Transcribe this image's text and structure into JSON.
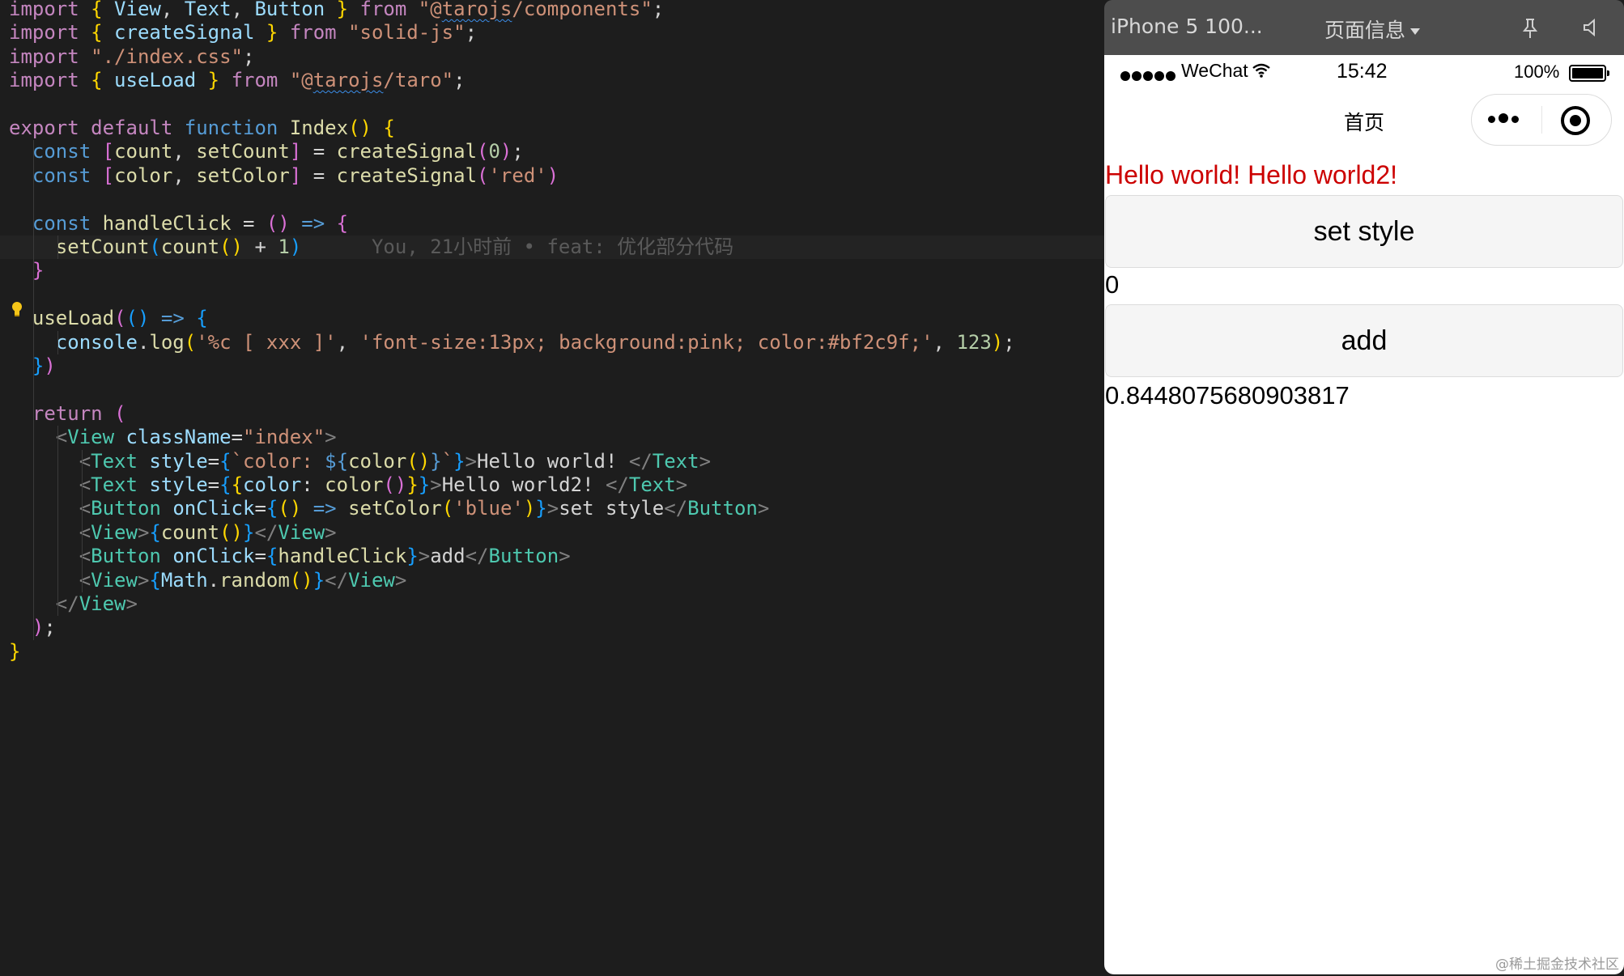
{
  "editor": {
    "lines": [
      [
        {
          "c": "kw-ctrl",
          "t": "import"
        },
        {
          "c": "text",
          "t": " "
        },
        {
          "c": "p1",
          "t": "{"
        },
        {
          "c": "var",
          "t": " View"
        },
        {
          "c": "text",
          "t": ", "
        },
        {
          "c": "var",
          "t": "Text"
        },
        {
          "c": "text",
          "t": ", "
        },
        {
          "c": "var",
          "t": "Button"
        },
        {
          "c": "text",
          "t": " "
        },
        {
          "c": "p1",
          "t": "}"
        },
        {
          "c": "text",
          "t": " "
        },
        {
          "c": "kw-ctrl",
          "t": "from"
        },
        {
          "c": "text",
          "t": " "
        },
        {
          "c": "str",
          "t": "\"@"
        },
        {
          "c": "str squig",
          "t": "tarojs"
        },
        {
          "c": "str",
          "t": "/components\""
        },
        {
          "c": "text",
          "t": ";"
        }
      ],
      [
        {
          "c": "kw-ctrl",
          "t": "import"
        },
        {
          "c": "text",
          "t": " "
        },
        {
          "c": "p1",
          "t": "{"
        },
        {
          "c": "var",
          "t": " createSignal"
        },
        {
          "c": "text",
          "t": " "
        },
        {
          "c": "p1",
          "t": "}"
        },
        {
          "c": "text",
          "t": " "
        },
        {
          "c": "kw-ctrl",
          "t": "from"
        },
        {
          "c": "text",
          "t": " "
        },
        {
          "c": "str",
          "t": "\"solid-js\""
        },
        {
          "c": "text",
          "t": ";"
        }
      ],
      [
        {
          "c": "kw-ctrl",
          "t": "import"
        },
        {
          "c": "text",
          "t": " "
        },
        {
          "c": "str",
          "t": "\"./index.css\""
        },
        {
          "c": "text",
          "t": ";"
        }
      ],
      [
        {
          "c": "kw-ctrl",
          "t": "import"
        },
        {
          "c": "text",
          "t": " "
        },
        {
          "c": "p1",
          "t": "{"
        },
        {
          "c": "var",
          "t": " useLoad"
        },
        {
          "c": "text",
          "t": " "
        },
        {
          "c": "p1",
          "t": "}"
        },
        {
          "c": "text",
          "t": " "
        },
        {
          "c": "kw-ctrl",
          "t": "from"
        },
        {
          "c": "text",
          "t": " "
        },
        {
          "c": "str",
          "t": "\"@"
        },
        {
          "c": "str squig",
          "t": "tarojs"
        },
        {
          "c": "str",
          "t": "/taro\""
        },
        {
          "c": "text",
          "t": ";"
        }
      ],
      [],
      [
        {
          "c": "kw-ctrl",
          "t": "export"
        },
        {
          "c": "text",
          "t": " "
        },
        {
          "c": "kw-ctrl",
          "t": "default"
        },
        {
          "c": "text",
          "t": " "
        },
        {
          "c": "kw",
          "t": "function"
        },
        {
          "c": "text",
          "t": " "
        },
        {
          "c": "fn",
          "t": "Index"
        },
        {
          "c": "p1",
          "t": "()"
        },
        {
          "c": "text",
          "t": " "
        },
        {
          "c": "p1",
          "t": "{"
        }
      ],
      [
        {
          "c": "text",
          "t": "  "
        },
        {
          "c": "kw",
          "t": "const"
        },
        {
          "c": "text",
          "t": " "
        },
        {
          "c": "p2",
          "t": "["
        },
        {
          "c": "fn",
          "t": "count"
        },
        {
          "c": "text",
          "t": ", "
        },
        {
          "c": "fn",
          "t": "setCount"
        },
        {
          "c": "p2",
          "t": "]"
        },
        {
          "c": "text",
          "t": " = "
        },
        {
          "c": "fn",
          "t": "createSignal"
        },
        {
          "c": "p2",
          "t": "("
        },
        {
          "c": "num",
          "t": "0"
        },
        {
          "c": "p2",
          "t": ")"
        },
        {
          "c": "text",
          "t": ";"
        }
      ],
      [
        {
          "c": "text",
          "t": "  "
        },
        {
          "c": "kw",
          "t": "const"
        },
        {
          "c": "text",
          "t": " "
        },
        {
          "c": "p2",
          "t": "["
        },
        {
          "c": "fn",
          "t": "color"
        },
        {
          "c": "text",
          "t": ", "
        },
        {
          "c": "fn",
          "t": "setColor"
        },
        {
          "c": "p2",
          "t": "]"
        },
        {
          "c": "text",
          "t": " = "
        },
        {
          "c": "fn",
          "t": "createSignal"
        },
        {
          "c": "p2",
          "t": "("
        },
        {
          "c": "str",
          "t": "'red'"
        },
        {
          "c": "p2",
          "t": ")"
        }
      ],
      [],
      [
        {
          "c": "text",
          "t": "  "
        },
        {
          "c": "kw",
          "t": "const"
        },
        {
          "c": "text",
          "t": " "
        },
        {
          "c": "fn",
          "t": "handleClick"
        },
        {
          "c": "text",
          "t": " = "
        },
        {
          "c": "p2",
          "t": "()"
        },
        {
          "c": "text",
          "t": " "
        },
        {
          "c": "kw",
          "t": "=>"
        },
        {
          "c": "text",
          "t": " "
        },
        {
          "c": "p2",
          "t": "{"
        }
      ],
      [
        {
          "c": "text",
          "t": "    "
        },
        {
          "c": "fn",
          "t": "setCount"
        },
        {
          "c": "p3",
          "t": "("
        },
        {
          "c": "fn",
          "t": "count"
        },
        {
          "c": "p1",
          "t": "()"
        },
        {
          "c": "text",
          "t": " + "
        },
        {
          "c": "num",
          "t": "1"
        },
        {
          "c": "p3",
          "t": ")"
        },
        {
          "c": "text",
          "t": "      "
        },
        {
          "c": "blame",
          "t": "You, 21小时前 • feat: 优化部分代码"
        }
      ],
      [
        {
          "c": "text",
          "t": "  "
        },
        {
          "c": "p2",
          "t": "}"
        }
      ],
      [],
      [
        {
          "c": "text",
          "t": "  "
        },
        {
          "c": "fn",
          "t": "useLoad"
        },
        {
          "c": "p2",
          "t": "("
        },
        {
          "c": "p3",
          "t": "()"
        },
        {
          "c": "text",
          "t": " "
        },
        {
          "c": "kw",
          "t": "=>"
        },
        {
          "c": "text",
          "t": " "
        },
        {
          "c": "p3",
          "t": "{"
        }
      ],
      [
        {
          "c": "text",
          "t": "    "
        },
        {
          "c": "var",
          "t": "console"
        },
        {
          "c": "text",
          "t": "."
        },
        {
          "c": "fn",
          "t": "log"
        },
        {
          "c": "p1",
          "t": "("
        },
        {
          "c": "str",
          "t": "'%c [ xxx ]'"
        },
        {
          "c": "text",
          "t": ", "
        },
        {
          "c": "str",
          "t": "'font-size:13px; background:pink; color:#bf2c9f;'"
        },
        {
          "c": "text",
          "t": ", "
        },
        {
          "c": "num",
          "t": "123"
        },
        {
          "c": "p1",
          "t": ")"
        },
        {
          "c": "text",
          "t": ";"
        }
      ],
      [
        {
          "c": "text",
          "t": "  "
        },
        {
          "c": "p3",
          "t": "}"
        },
        {
          "c": "p2",
          "t": ")"
        }
      ],
      [],
      [
        {
          "c": "text",
          "t": "  "
        },
        {
          "c": "kw-ctrl",
          "t": "return"
        },
        {
          "c": "text",
          "t": " "
        },
        {
          "c": "p2",
          "t": "("
        }
      ],
      [
        {
          "c": "text",
          "t": "    "
        },
        {
          "c": "punc",
          "t": "<"
        },
        {
          "c": "tag",
          "t": "View"
        },
        {
          "c": "text",
          "t": " "
        },
        {
          "c": "var",
          "t": "className"
        },
        {
          "c": "text",
          "t": "="
        },
        {
          "c": "str",
          "t": "\"index\""
        },
        {
          "c": "punc",
          "t": ">"
        }
      ],
      [
        {
          "c": "text",
          "t": "      "
        },
        {
          "c": "punc",
          "t": "<"
        },
        {
          "c": "tag",
          "t": "Text"
        },
        {
          "c": "text",
          "t": " "
        },
        {
          "c": "var",
          "t": "style"
        },
        {
          "c": "text",
          "t": "="
        },
        {
          "c": "p3",
          "t": "{"
        },
        {
          "c": "str",
          "t": "`color: "
        },
        {
          "c": "kw",
          "t": "${"
        },
        {
          "c": "fn",
          "t": "color"
        },
        {
          "c": "p1",
          "t": "()"
        },
        {
          "c": "kw",
          "t": "}"
        },
        {
          "c": "str",
          "t": "`"
        },
        {
          "c": "p3",
          "t": "}"
        },
        {
          "c": "punc",
          "t": ">"
        },
        {
          "c": "text",
          "t": "Hello world! "
        },
        {
          "c": "punc",
          "t": "</"
        },
        {
          "c": "tag",
          "t": "Text"
        },
        {
          "c": "punc",
          "t": ">"
        }
      ],
      [
        {
          "c": "text",
          "t": "      "
        },
        {
          "c": "punc",
          "t": "<"
        },
        {
          "c": "tag",
          "t": "Text"
        },
        {
          "c": "text",
          "t": " "
        },
        {
          "c": "var",
          "t": "style"
        },
        {
          "c": "text",
          "t": "="
        },
        {
          "c": "p3",
          "t": "{"
        },
        {
          "c": "p1",
          "t": "{"
        },
        {
          "c": "var",
          "t": "color"
        },
        {
          "c": "text",
          "t": ": "
        },
        {
          "c": "fn",
          "t": "color"
        },
        {
          "c": "p2",
          "t": "()"
        },
        {
          "c": "p1",
          "t": "}"
        },
        {
          "c": "p3",
          "t": "}"
        },
        {
          "c": "punc",
          "t": ">"
        },
        {
          "c": "text",
          "t": "Hello world2! "
        },
        {
          "c": "punc",
          "t": "</"
        },
        {
          "c": "tag",
          "t": "Text"
        },
        {
          "c": "punc",
          "t": ">"
        }
      ],
      [
        {
          "c": "text",
          "t": "      "
        },
        {
          "c": "punc",
          "t": "<"
        },
        {
          "c": "tag",
          "t": "Button"
        },
        {
          "c": "text",
          "t": " "
        },
        {
          "c": "var",
          "t": "onClick"
        },
        {
          "c": "text",
          "t": "="
        },
        {
          "c": "p3",
          "t": "{"
        },
        {
          "c": "p1",
          "t": "()"
        },
        {
          "c": "text",
          "t": " "
        },
        {
          "c": "kw",
          "t": "=>"
        },
        {
          "c": "text",
          "t": " "
        },
        {
          "c": "fn",
          "t": "setColor"
        },
        {
          "c": "p1",
          "t": "("
        },
        {
          "c": "str",
          "t": "'blue'"
        },
        {
          "c": "p1",
          "t": ")"
        },
        {
          "c": "p3",
          "t": "}"
        },
        {
          "c": "punc",
          "t": ">"
        },
        {
          "c": "text",
          "t": "set style"
        },
        {
          "c": "punc",
          "t": "</"
        },
        {
          "c": "tag",
          "t": "Button"
        },
        {
          "c": "punc",
          "t": ">"
        }
      ],
      [
        {
          "c": "text",
          "t": "      "
        },
        {
          "c": "punc",
          "t": "<"
        },
        {
          "c": "tag",
          "t": "View"
        },
        {
          "c": "punc",
          "t": ">"
        },
        {
          "c": "p3",
          "t": "{"
        },
        {
          "c": "fn",
          "t": "count"
        },
        {
          "c": "p1",
          "t": "()"
        },
        {
          "c": "p3",
          "t": "}"
        },
        {
          "c": "punc",
          "t": "</"
        },
        {
          "c": "tag",
          "t": "View"
        },
        {
          "c": "punc",
          "t": ">"
        }
      ],
      [
        {
          "c": "text",
          "t": "      "
        },
        {
          "c": "punc",
          "t": "<"
        },
        {
          "c": "tag",
          "t": "Button"
        },
        {
          "c": "text",
          "t": " "
        },
        {
          "c": "var",
          "t": "onClick"
        },
        {
          "c": "text",
          "t": "="
        },
        {
          "c": "p3",
          "t": "{"
        },
        {
          "c": "fn",
          "t": "handleClick"
        },
        {
          "c": "p3",
          "t": "}"
        },
        {
          "c": "punc",
          "t": ">"
        },
        {
          "c": "text",
          "t": "add"
        },
        {
          "c": "punc",
          "t": "</"
        },
        {
          "c": "tag",
          "t": "Button"
        },
        {
          "c": "punc",
          "t": ">"
        }
      ],
      [
        {
          "c": "text",
          "t": "      "
        },
        {
          "c": "punc",
          "t": "<"
        },
        {
          "c": "tag",
          "t": "View"
        },
        {
          "c": "punc",
          "t": ">"
        },
        {
          "c": "p3",
          "t": "{"
        },
        {
          "c": "var",
          "t": "Math"
        },
        {
          "c": "text",
          "t": "."
        },
        {
          "c": "fn",
          "t": "random"
        },
        {
          "c": "p1",
          "t": "()"
        },
        {
          "c": "p3",
          "t": "}"
        },
        {
          "c": "punc",
          "t": "</"
        },
        {
          "c": "tag",
          "t": "View"
        },
        {
          "c": "punc",
          "t": ">"
        }
      ],
      [
        {
          "c": "text",
          "t": "    "
        },
        {
          "c": "punc",
          "t": "</"
        },
        {
          "c": "tag",
          "t": "View"
        },
        {
          "c": "punc",
          "t": ">"
        }
      ],
      [
        {
          "c": "text",
          "t": "  "
        },
        {
          "c": "p2",
          "t": ")"
        },
        {
          "c": "text",
          "t": ";"
        }
      ],
      [
        {
          "c": "p1",
          "t": "}"
        }
      ]
    ],
    "current_line": 10,
    "lightbulb_icon": "lightbulb-icon"
  },
  "simulator": {
    "toolbar": {
      "device": "iPhone 5 100...",
      "page_info": "页面信息",
      "pin_icon": "pin-icon",
      "sound_icon": "sound-icon"
    },
    "status_bar": {
      "carrier": "WeChat",
      "time": "15:42",
      "battery": "100%"
    },
    "navbar": {
      "title": "首页"
    },
    "page": {
      "hello_text": "Hello world! Hello world2!",
      "hello_color": "#cc0000",
      "set_style_label": "set style",
      "count_value": "0",
      "add_label": "add",
      "random_value": "0.8448075680903817"
    },
    "watermark": "@稀土掘金技术社区"
  }
}
